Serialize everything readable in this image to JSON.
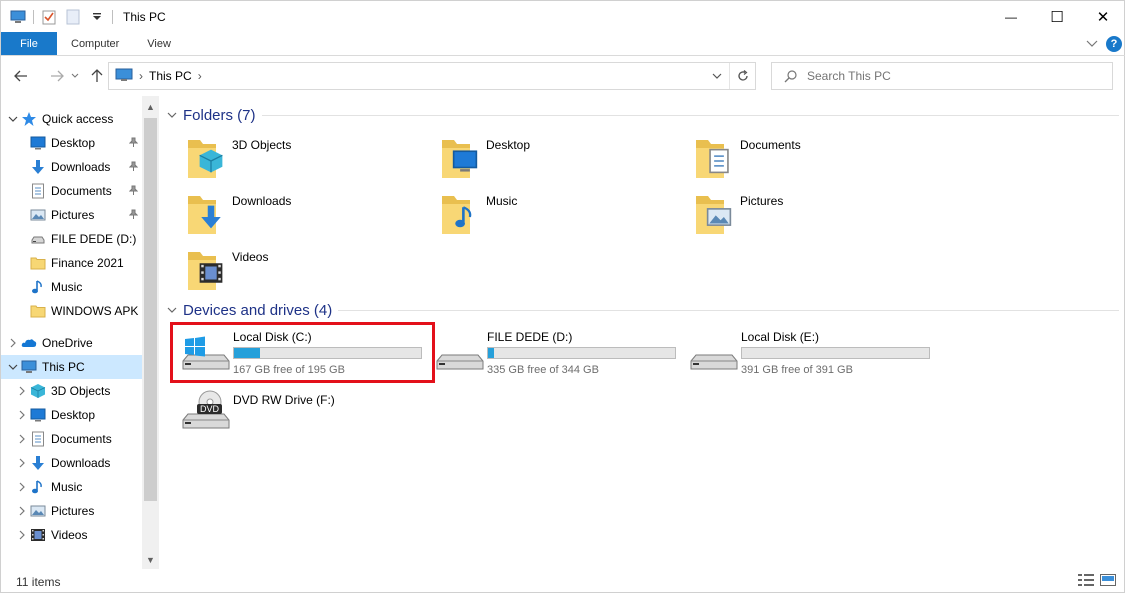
{
  "window": {
    "title": "This PC",
    "minimize_glyph": "—",
    "maximize_glyph": "☐",
    "close_glyph": "✕"
  },
  "ribbon": {
    "tabs": [
      "File",
      "Computer",
      "View"
    ],
    "help_label": "?"
  },
  "address": {
    "crumbs": [
      "This PC"
    ]
  },
  "search": {
    "placeholder": "Search This PC"
  },
  "navpane": {
    "items": [
      {
        "label": "Quick access",
        "icon": "star-icon",
        "level": 0,
        "expander": "v"
      },
      {
        "label": "Desktop",
        "icon": "desktop-icon",
        "level": 1,
        "pinned": true
      },
      {
        "label": "Downloads",
        "icon": "downloads-icon",
        "level": 1,
        "pinned": true
      },
      {
        "label": "Documents",
        "icon": "documents-icon",
        "level": 1,
        "pinned": true
      },
      {
        "label": "Pictures",
        "icon": "pictures-icon",
        "level": 1,
        "pinned": true
      },
      {
        "label": "FILE DEDE (D:)",
        "icon": "drive-icon",
        "level": 1
      },
      {
        "label": "Finance 2021",
        "icon": "folder-icon",
        "level": 1
      },
      {
        "label": "Music",
        "icon": "music-icon",
        "level": 1
      },
      {
        "label": "WINDOWS APK",
        "icon": "folder-icon",
        "level": 1
      },
      {
        "label": "OneDrive",
        "icon": "onedrive-icon",
        "level": 0,
        "expander": ">"
      },
      {
        "label": "This PC",
        "icon": "this-pc-icon",
        "level": 0,
        "expander": "v",
        "selected": true
      },
      {
        "label": "3D Objects",
        "icon": "3d-objects-icon",
        "level": 1,
        "expander": ">"
      },
      {
        "label": "Desktop",
        "icon": "desktop-icon",
        "level": 1,
        "expander": ">"
      },
      {
        "label": "Documents",
        "icon": "documents-icon",
        "level": 1,
        "expander": ">"
      },
      {
        "label": "Downloads",
        "icon": "downloads-icon",
        "level": 1,
        "expander": ">"
      },
      {
        "label": "Music",
        "icon": "music-icon",
        "level": 1,
        "expander": ">"
      },
      {
        "label": "Pictures",
        "icon": "pictures-icon",
        "level": 1,
        "expander": ">"
      },
      {
        "label": "Videos",
        "icon": "videos-icon",
        "level": 1,
        "expander": ">"
      }
    ]
  },
  "content": {
    "folders_header": "Folders (7)",
    "drives_header": "Devices and drives (4)",
    "folders": [
      {
        "label": "3D Objects",
        "overlay": "3d-objects-icon"
      },
      {
        "label": "Desktop",
        "overlay": "desktop-icon"
      },
      {
        "label": "Documents",
        "overlay": "documents-icon"
      },
      {
        "label": "Downloads",
        "overlay": "downloads-icon"
      },
      {
        "label": "Music",
        "overlay": "music-icon"
      },
      {
        "label": "Pictures",
        "overlay": "pictures-icon"
      },
      {
        "label": "Videos",
        "overlay": "videos-icon"
      }
    ],
    "drives": [
      {
        "name": "Local Disk (C:)",
        "free": "167 GB free of 195 GB",
        "used_fraction": 0.14,
        "icon": "windows-drive-icon",
        "highlighted": true
      },
      {
        "name": "FILE DEDE (D:)",
        "free": "335 GB free of 344 GB",
        "used_fraction": 0.03,
        "icon": "drive-icon"
      },
      {
        "name": "Local Disk (E:)",
        "free": "391 GB free of 391 GB",
        "used_fraction": 0.0,
        "icon": "drive-icon"
      },
      {
        "name": "DVD RW Drive (F:)",
        "free": "",
        "icon": "dvd-drive-icon",
        "dvd_label": "DVD"
      }
    ]
  },
  "status": {
    "item_count": "11 items"
  },
  "colors": {
    "accent": "#1979ca",
    "selection": "#cce8ff",
    "group_header": "#1e3287",
    "highlight_box": "#e3101a",
    "bar_fill": "#26a0da"
  }
}
